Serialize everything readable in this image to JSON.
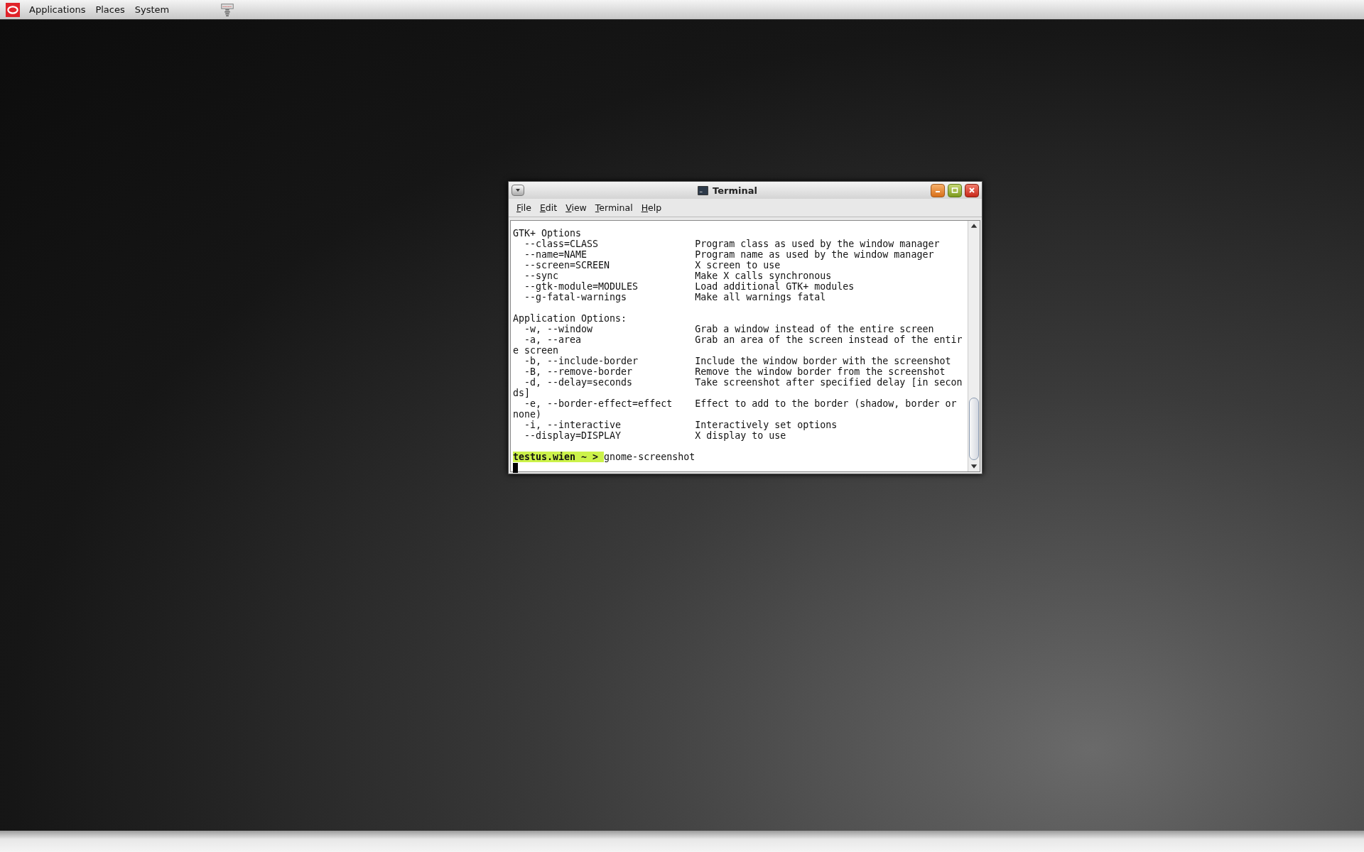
{
  "top_panel": {
    "menus": [
      "Applications",
      "Places",
      "System"
    ]
  },
  "window": {
    "title": "Terminal",
    "menu": [
      "File",
      "Edit",
      "View",
      "Terminal",
      "Help"
    ],
    "sections": [
      {
        "lines": [
          "GTK+ Options",
          "  --class=CLASS                 Program class as used by the window manager",
          "  --name=NAME                   Program name as used by the window manager",
          "  --screen=SCREEN               X screen to use",
          "  --sync                        Make X calls synchronous",
          "  --gtk-module=MODULES          Load additional GTK+ modules",
          "  --g-fatal-warnings            Make all warnings fatal"
        ]
      },
      {
        "lines": [
          "Application Options:",
          "  -w, --window                  Grab a window instead of the entire screen",
          "  -a, --area                    Grab an area of the screen instead of the entir",
          "e screen",
          "  -b, --include-border          Include the window border with the screenshot",
          "  -B, --remove-border           Remove the window border from the screenshot",
          "  -d, --delay=seconds           Take screenshot after specified delay [in secon",
          "ds]",
          "  -e, --border-effect=effect    Effect to add to the border (shadow, border or ",
          "none)",
          "  -i, --interactive             Interactively set options",
          "  --display=DISPLAY             X display to use"
        ]
      }
    ],
    "prompt": {
      "user": "testus.wien ~ >",
      "command": "gnome-screenshot"
    }
  }
}
